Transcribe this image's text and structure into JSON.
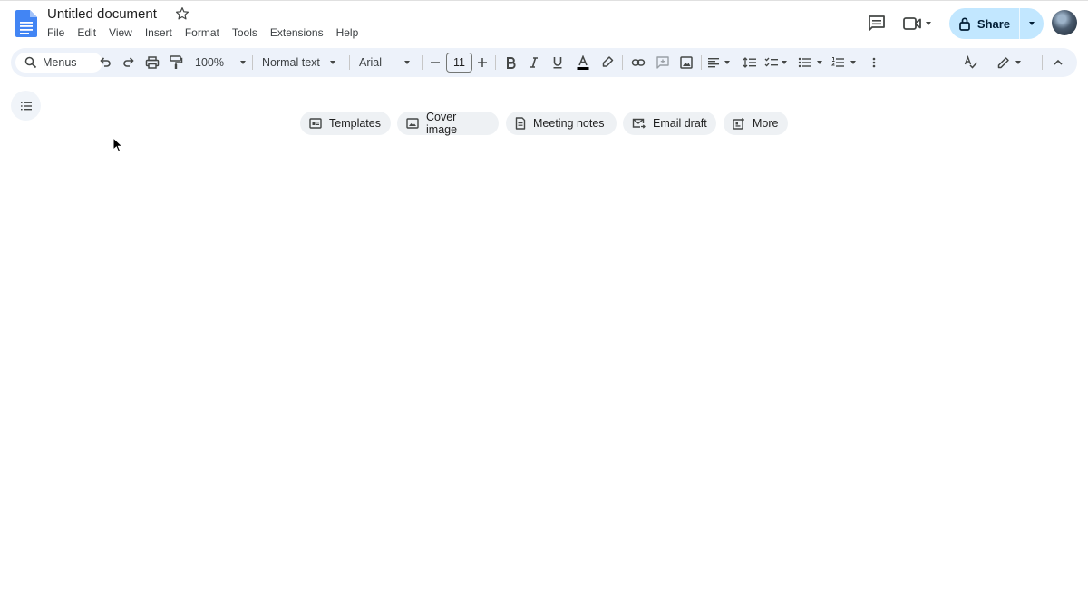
{
  "document": {
    "title": "Untitled document"
  },
  "menubar": [
    "File",
    "Edit",
    "View",
    "Insert",
    "Format",
    "Tools",
    "Extensions",
    "Help"
  ],
  "header": {
    "share_label": "Share"
  },
  "toolbar": {
    "search_label": "Menus",
    "zoom": "100%",
    "style": "Normal text",
    "font": "Arial",
    "font_size": "11"
  },
  "chips": {
    "templates": "Templates",
    "cover_image": "Cover image",
    "meeting_notes": "Meeting notes",
    "email_draft": "Email draft",
    "more": "More"
  },
  "colors": {
    "share_bg": "#c2e7ff",
    "toolbar_bg": "#edf2fa",
    "docs_blue": "#4285f4"
  }
}
